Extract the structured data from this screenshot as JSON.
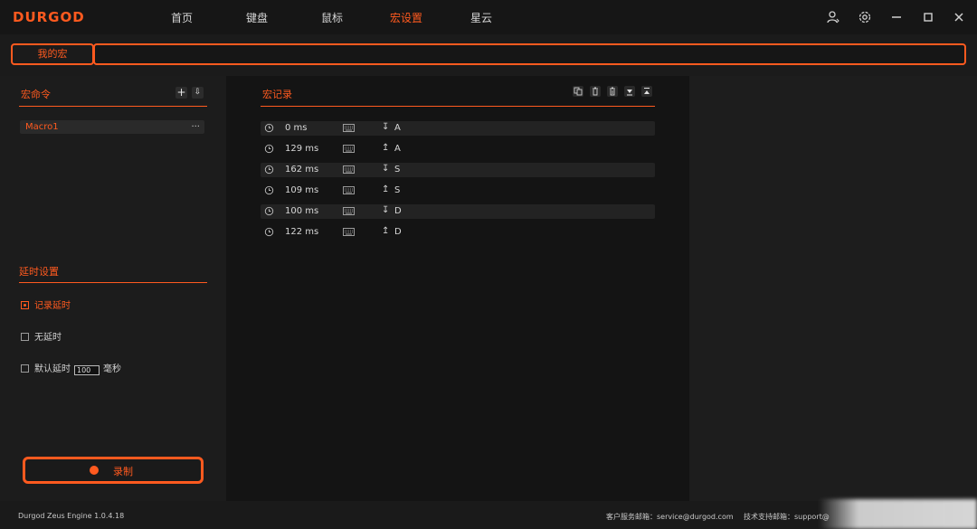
{
  "app": {
    "logo": "DURGOD"
  },
  "nav": [
    {
      "label": "首页"
    },
    {
      "label": "键盘"
    },
    {
      "label": "鼠标"
    },
    {
      "label": "宏设置",
      "active": true
    },
    {
      "label": "星云"
    }
  ],
  "window_controls": [
    "user-icon",
    "settings-icon",
    "minimize-icon",
    "maximize-icon",
    "close-icon"
  ],
  "subbar": {
    "my_macro_label": "我的宏",
    "input_value": ""
  },
  "left": {
    "macro_cmd_title": "宏命令",
    "add_button": "+",
    "import_button": "⇩",
    "macros": [
      {
        "name": "Macro1",
        "menu": "···"
      }
    ],
    "delay_title": "延时设置",
    "delay_options": {
      "record": "记录延时",
      "none": "无延时",
      "default": "默认延时",
      "default_value": "100",
      "unit": "毫秒"
    },
    "record_button": "录制"
  },
  "middle": {
    "title": "宏记录",
    "records": [
      {
        "ms": "0 ms",
        "dir": "↧",
        "key": "A"
      },
      {
        "ms": "129 ms",
        "dir": "↥",
        "key": "A"
      },
      {
        "ms": "162 ms",
        "dir": "↧",
        "key": "S"
      },
      {
        "ms": "109 ms",
        "dir": "↥",
        "key": "S"
      },
      {
        "ms": "100 ms",
        "dir": "↧",
        "key": "D"
      },
      {
        "ms": "122 ms",
        "dir": "↥",
        "key": "D"
      }
    ]
  },
  "footer": {
    "version": "Durgod Zeus Engine 1.0.4.18",
    "service": "客户服务邮箱：service@durgod.com",
    "support": "技术支持邮箱：support@"
  },
  "colors": {
    "accent": "#ff5a1f",
    "bg": "#141414",
    "panel": "#1c1c1c"
  }
}
